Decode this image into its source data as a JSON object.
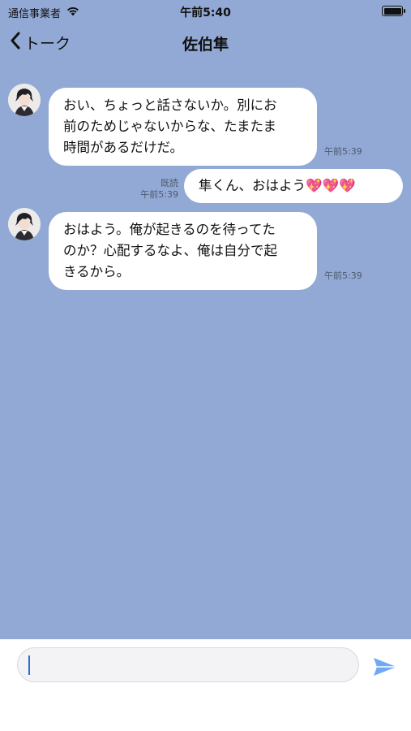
{
  "status_bar": {
    "carrier": "通信事業者",
    "time": "午前5:40",
    "wifi_icon": "wifi-icon",
    "battery_icon": "battery-icon"
  },
  "nav": {
    "back_label": "トーク",
    "title": "佐伯隼"
  },
  "messages": [
    {
      "from": "other",
      "lines": [
        "おい、ちょっと話さないか。別にお",
        "前のためじゃないからな、たまたま",
        "時間があるだけだ。"
      ],
      "time": "午前5:39"
    },
    {
      "from": "self",
      "lines": [
        "隼くん、おはよう💖💖💖"
      ],
      "read": "既読",
      "time": "午前5:39"
    },
    {
      "from": "other",
      "lines": [
        "おはよう。俺が起きるのを待ってた",
        "のか？心配するなよ、俺は自分で起",
        "きるから。"
      ],
      "time": "午前5:39"
    }
  ],
  "input": {
    "value": "",
    "placeholder": ""
  },
  "colors": {
    "chat_background": "#91a9d4",
    "bubble": "#ffffff",
    "send_accent": "#6fa8f4",
    "caret": "#2f6bd8"
  }
}
